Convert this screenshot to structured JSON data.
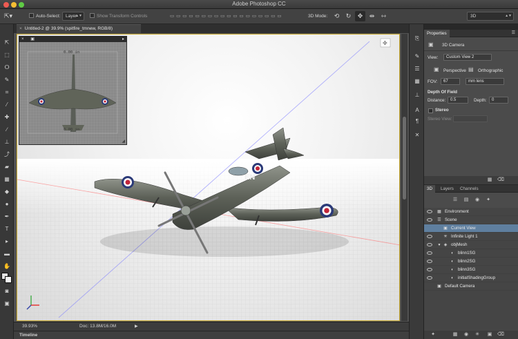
{
  "app": {
    "title": "Adobe Photoshop CC",
    "colors": {
      "close": "#ee5a52",
      "minimize": "#f5be33",
      "maximize": "#5fcb45",
      "canvas_border": "#c9a92c",
      "selection": "#5f7f9f"
    }
  },
  "options": {
    "tool_icon": "move-tool-icon",
    "auto_select_label": "Auto-Select:",
    "auto_select_value": "Layer",
    "show_transform_label": "Show Transform Controls",
    "mode_label": "3D Mode:",
    "workspace": "3D"
  },
  "document": {
    "tab_title": "Untitled-2 @ 39.9% (spitfire_tmnew, RGB/8)",
    "tab_close": "×",
    "zoom": "39.93%",
    "doc_info": "Doc: 13.8M/16.0M",
    "timeline_label": "Timeline"
  },
  "secondary_view": {
    "labels": [
      "0.00 in",
      "0.00 in"
    ]
  },
  "properties": {
    "tab": "Properties",
    "section": "3D Camera",
    "view_label": "View:",
    "view_value": "Custom View 2",
    "perspective": "Perspective",
    "orthographic": "Orthographic",
    "fov_label": "FOV:",
    "fov_value": "67",
    "lens_value": "mm lens",
    "dof_title": "Depth Of Field",
    "distance_label": "Distance:",
    "distance_value": "0.5",
    "depth_label": "Depth:",
    "depth_value": "0",
    "stereo_label": "Stereo",
    "stereo_view_label": "Stereo View:"
  },
  "panel3d": {
    "tabs": [
      "3D",
      "Layers",
      "Channels"
    ],
    "items": [
      {
        "name": "Environment",
        "indent": 0,
        "icon": "environment-icon",
        "selected": false
      },
      {
        "name": "Scene",
        "indent": 0,
        "icon": "scene-icon",
        "selected": false
      },
      {
        "name": "Current View",
        "indent": 1,
        "icon": "camera-icon",
        "selected": true
      },
      {
        "name": "Infinite Light 1",
        "indent": 1,
        "icon": "light-icon",
        "selected": false
      },
      {
        "name": "objMesh",
        "indent": 1,
        "icon": "mesh-icon",
        "selected": false
      },
      {
        "name": "blinn1SG",
        "indent": 2,
        "icon": "material-icon",
        "selected": false
      },
      {
        "name": "blinn2SG",
        "indent": 2,
        "icon": "material-icon",
        "selected": false
      },
      {
        "name": "blinn3SG",
        "indent": 2,
        "icon": "material-icon",
        "selected": false
      },
      {
        "name": "initialShadingGroup",
        "indent": 2,
        "icon": "material-icon",
        "selected": false
      },
      {
        "name": "Default Camera",
        "indent": 0,
        "icon": "camera-icon",
        "selected": false
      }
    ]
  }
}
